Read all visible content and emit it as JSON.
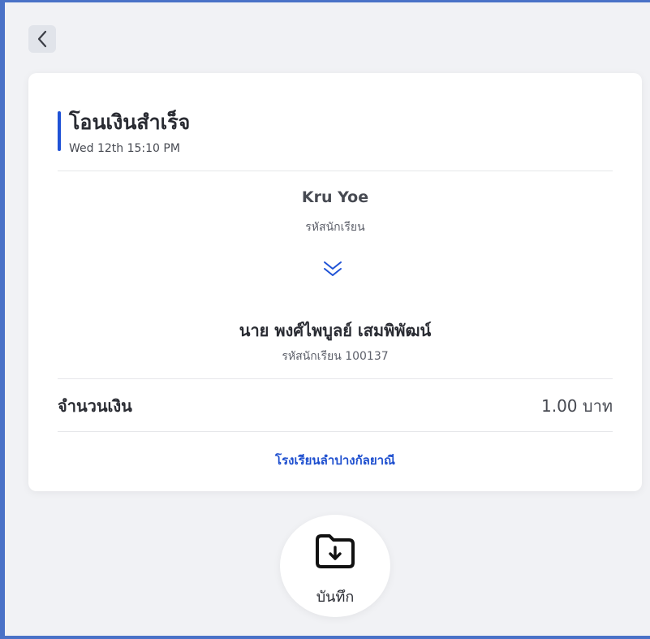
{
  "header": {
    "back_icon": "chevron-left-icon"
  },
  "receipt": {
    "status_title": "โอนเงินสำเร็จ",
    "timestamp": "Wed 12th 15:10 PM",
    "accent_color": "#1f52d6",
    "sender": {
      "name": "Kru Yoe",
      "subtitle": "รหัสนักเรียน"
    },
    "transfer_icon": "double-chevron-down-icon",
    "recipient": {
      "name": "นาย พงศ์ไพบูลย์ เสมพิพัฒน์",
      "subtitle": "รหัสนักเรียน 100137"
    },
    "amount_label": "จำนวนเงิน",
    "amount_value": "1.00 บาท",
    "school_name": "โรงเรียนลำปางกัลยาณี",
    "link_color": "#1e4fcf"
  },
  "actions": {
    "save_label": "บันทึก",
    "save_icon": "folder-download-icon"
  }
}
